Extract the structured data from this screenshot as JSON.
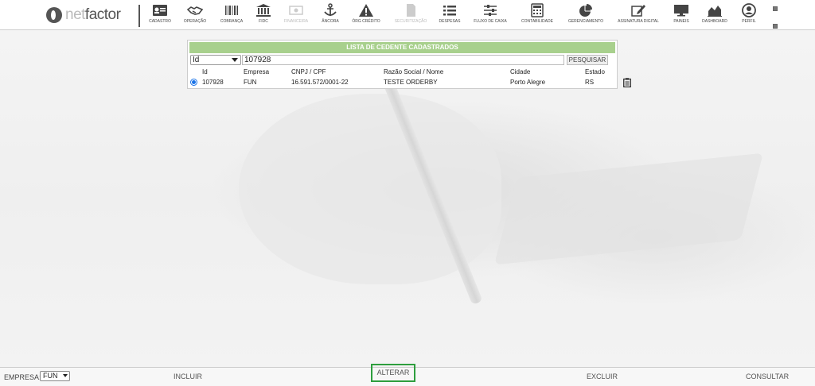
{
  "brand": {
    "net": "net",
    "factor": "factor"
  },
  "nav": [
    {
      "key": "cadastro",
      "label": "CADASTRO",
      "icon": "id-card-icon",
      "enabled": true
    },
    {
      "key": "operacao",
      "label": "OPERAÇÃO",
      "icon": "handshake-icon",
      "enabled": true
    },
    {
      "key": "cobranca",
      "label": "COBRANÇA",
      "icon": "barcode-icon",
      "enabled": true
    },
    {
      "key": "fidc",
      "label": "FIDC",
      "icon": "bank-icon",
      "enabled": true
    },
    {
      "key": "financeira",
      "label": "FINANCEIRA",
      "icon": "money-icon",
      "enabled": false
    },
    {
      "key": "ancora",
      "label": "ÂNCORA",
      "icon": "anchor-icon",
      "enabled": true
    },
    {
      "key": "orc_credito",
      "label": "ÓRG CRÉDITO",
      "icon": "warning-icon",
      "enabled": true
    },
    {
      "key": "securitizacao",
      "label": "SECURITIZAÇÃO",
      "icon": "document-icon",
      "enabled": false
    },
    {
      "key": "despesas",
      "label": "DESPESAS",
      "icon": "list-icon",
      "enabled": true
    },
    {
      "key": "fluxo_caixa",
      "label": "FLUXO DE CAIXA",
      "icon": "sliders-icon",
      "enabled": true
    },
    {
      "key": "contabilidade",
      "label": "CONTABILIDADE",
      "icon": "calculator-icon",
      "enabled": true
    },
    {
      "key": "gerenciamento",
      "label": "GERENCIAMENTO",
      "icon": "pie-chart-icon",
      "enabled": true
    },
    {
      "key": "assinatura",
      "label": "ASSINATURA DIGITAL",
      "icon": "edit-icon",
      "enabled": true
    },
    {
      "key": "paineis",
      "label": "PAINEIS",
      "icon": "monitor-icon",
      "enabled": true
    },
    {
      "key": "dashboard",
      "label": "DASHBOARD",
      "icon": "area-chart-icon",
      "enabled": true
    },
    {
      "key": "perfil",
      "label": "PERFIL",
      "icon": "user-circle-icon",
      "enabled": true
    }
  ],
  "panel": {
    "title": "LISTA DE CEDENTE CADASTRADOS",
    "search_field": "Id",
    "search_value": "107928",
    "search_button": "PESQUISAR",
    "columns": [
      "Id",
      "Empresa",
      "CNPJ / CPF",
      "Razão Social / Nome",
      "Cidade",
      "Estado"
    ],
    "rows": [
      {
        "id": "107928",
        "empresa": "FUN",
        "cnpj": "16.591.572/0001-22",
        "razao": "TESTE ORDERBY",
        "cidade": "Porto Alegre",
        "estado": "RS",
        "selected": true
      }
    ]
  },
  "bottom": {
    "empresa_label": "EMPRESA:",
    "empresa_value": "FUN",
    "incluir": "INCLUIR",
    "alterar": "ALTERAR",
    "excluir": "EXCLUIR",
    "consultar": "CONSULTAR"
  },
  "colors": {
    "accent_green": "#a8d08d",
    "highlight_border": "#2e9e3e",
    "radio": "#1a73e8"
  }
}
